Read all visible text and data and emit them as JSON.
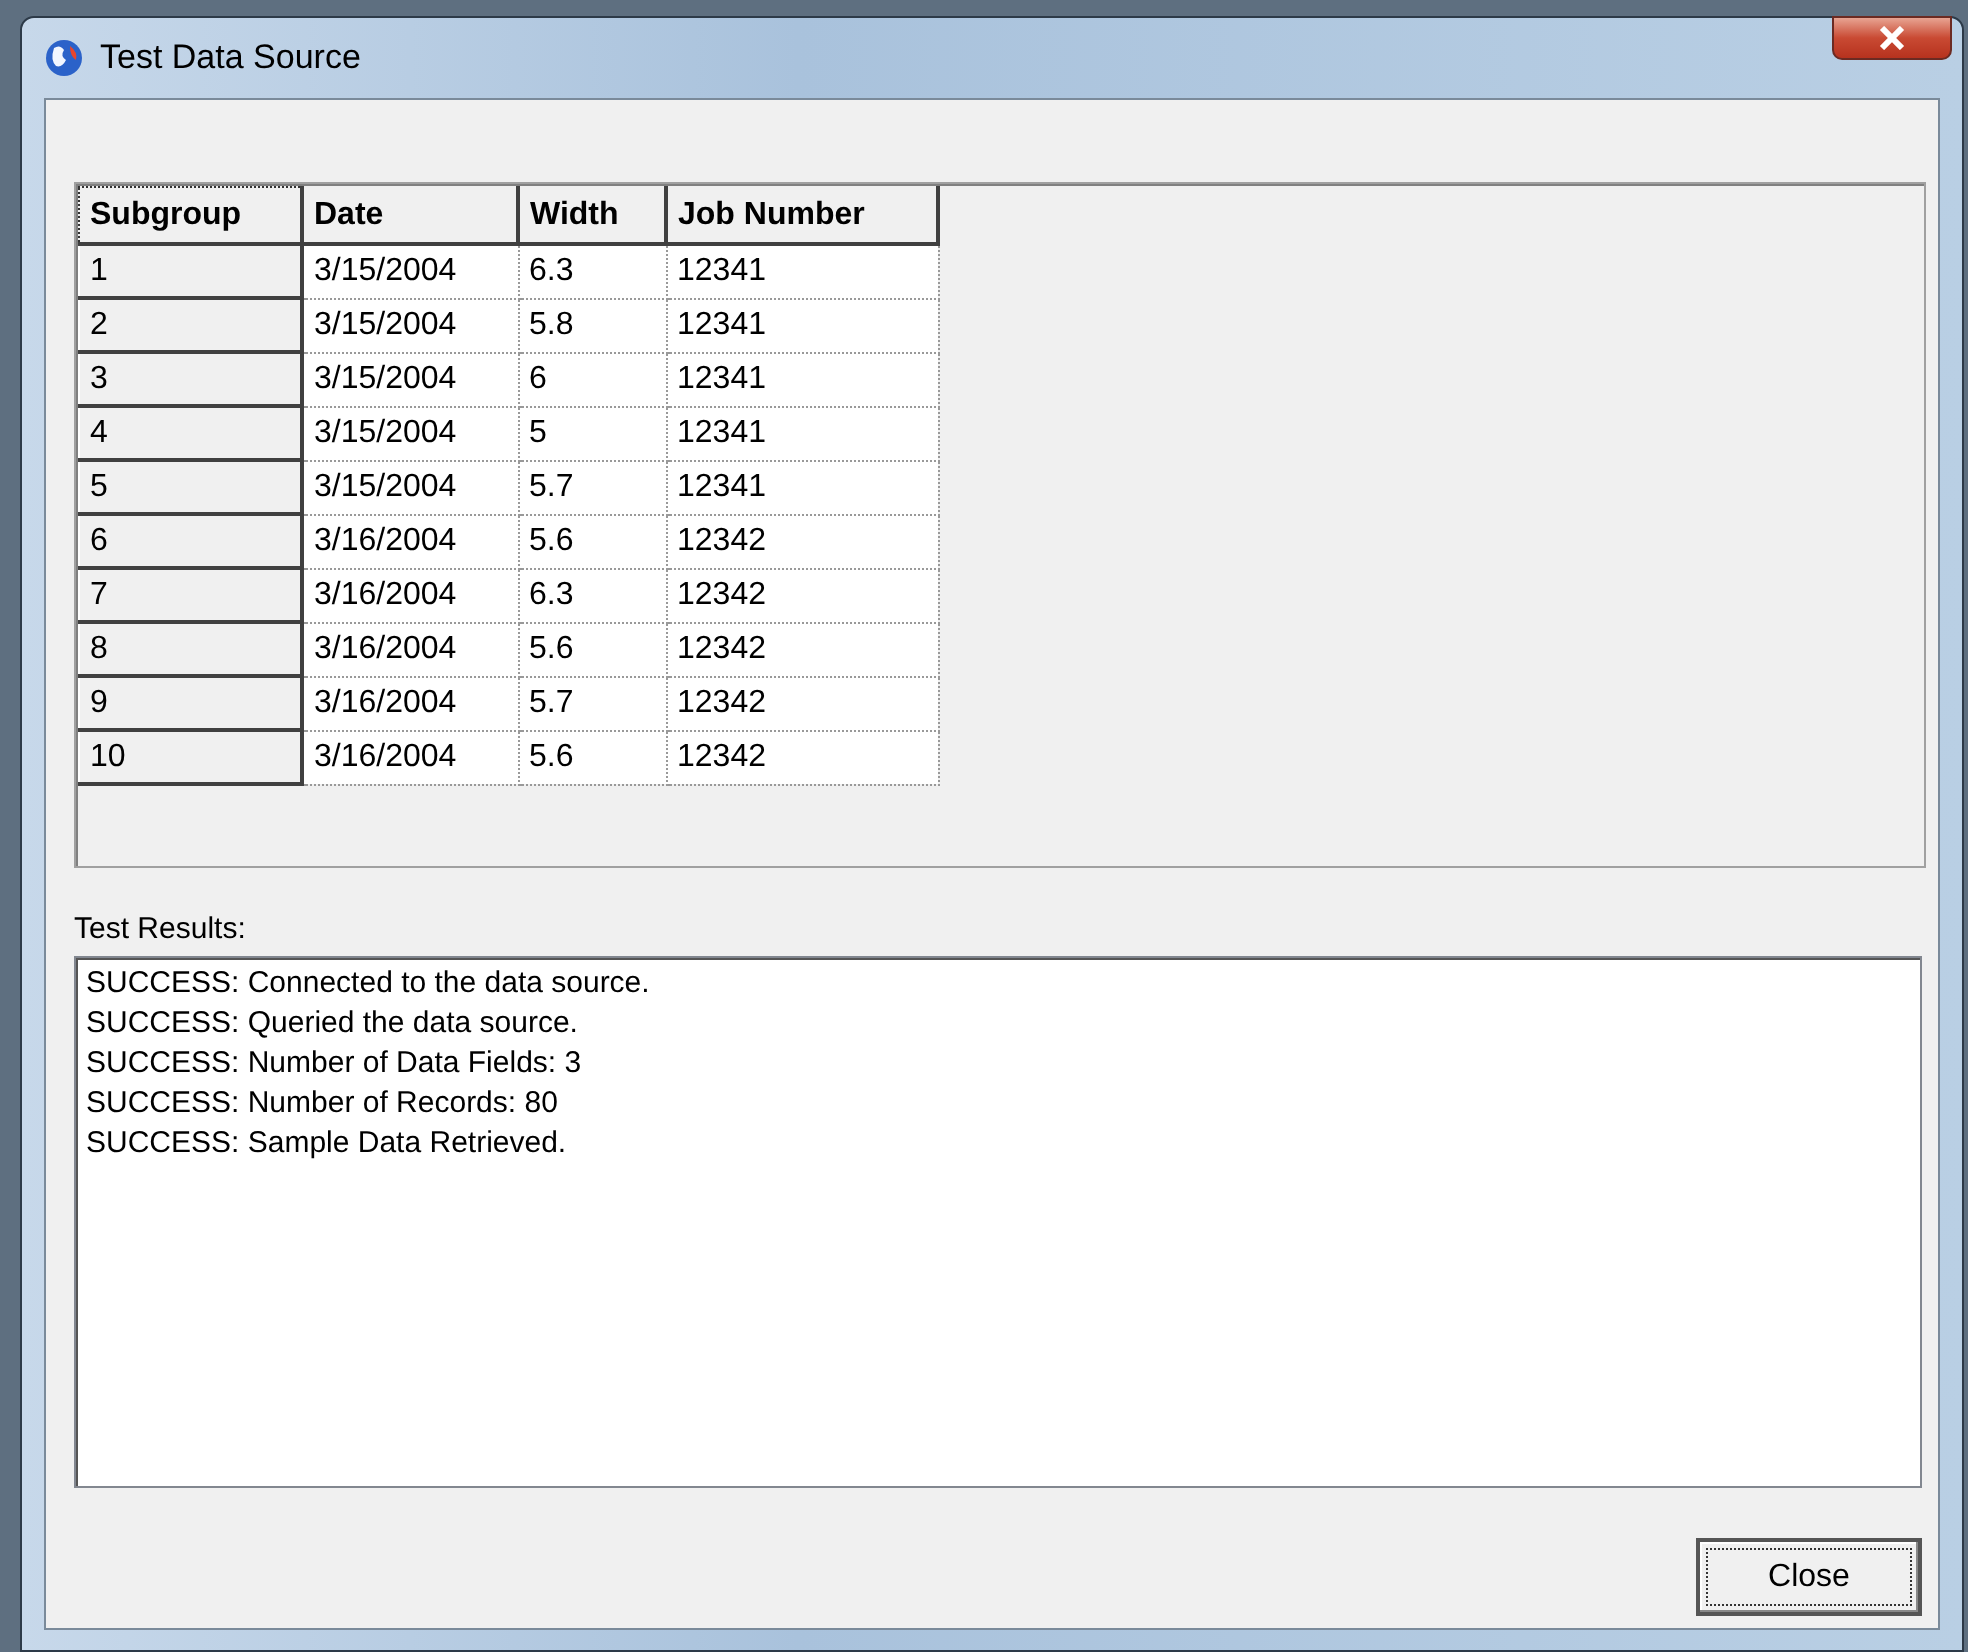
{
  "window": {
    "title": "Test Data Source"
  },
  "table": {
    "columns": [
      "Subgroup",
      "Date",
      "Width",
      "Job Number"
    ],
    "rows": [
      [
        "1",
        "3/15/2004",
        "6.3",
        "12341"
      ],
      [
        "2",
        "3/15/2004",
        "5.8",
        "12341"
      ],
      [
        "3",
        "3/15/2004",
        "6",
        "12341"
      ],
      [
        "4",
        "3/15/2004",
        "5",
        "12341"
      ],
      [
        "5",
        "3/15/2004",
        "5.7",
        "12341"
      ],
      [
        "6",
        "3/16/2004",
        "5.6",
        "12342"
      ],
      [
        "7",
        "3/16/2004",
        "6.3",
        "12342"
      ],
      [
        "8",
        "3/16/2004",
        "5.6",
        "12342"
      ],
      [
        "9",
        "3/16/2004",
        "5.7",
        "12342"
      ],
      [
        "10",
        "3/16/2004",
        "5.6",
        "12342"
      ]
    ]
  },
  "results": {
    "label": "Test Results:",
    "lines": [
      "SUCCESS: Connected to the data source.",
      "SUCCESS: Queried the data source.",
      "SUCCESS: Number of Data Fields: 3",
      "SUCCESS: Number of Records: 80",
      "SUCCESS: Sample Data Retrieved."
    ]
  },
  "buttons": [
    "Close"
  ]
}
